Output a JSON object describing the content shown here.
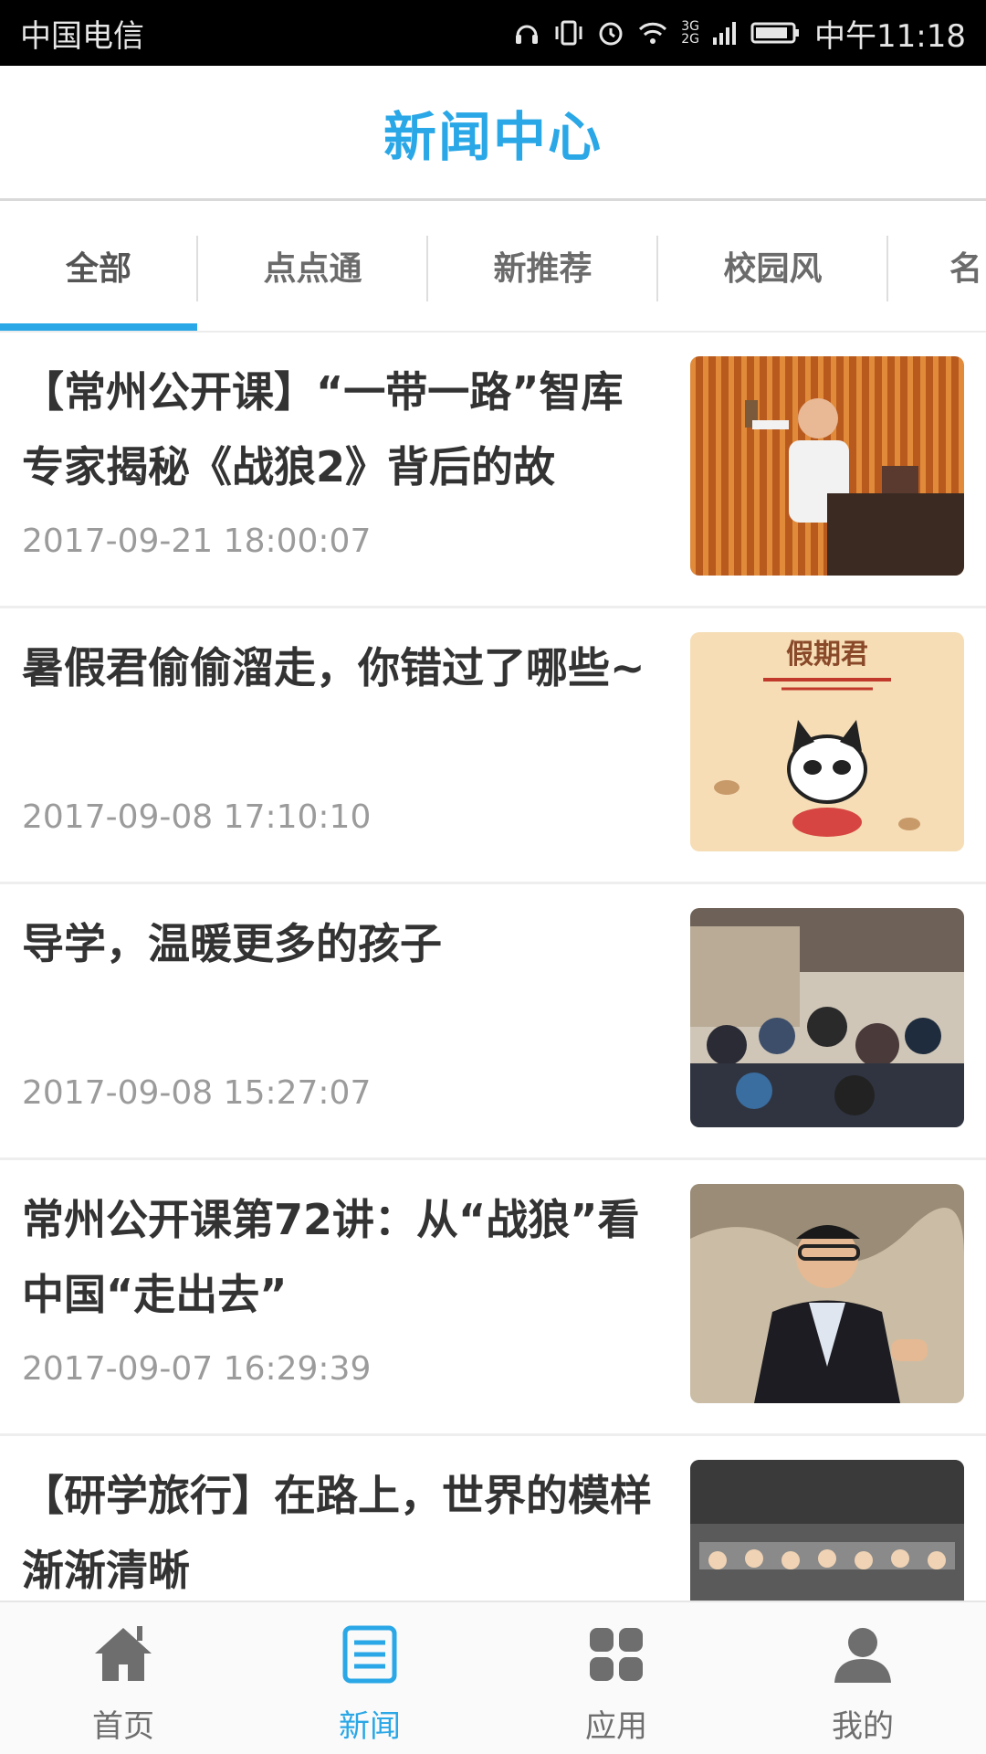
{
  "status_bar": {
    "carrier": "中国电信",
    "network": [
      "3G",
      "2G"
    ],
    "time": "中午11:18"
  },
  "header": {
    "title": "新闻中心"
  },
  "tabs": [
    {
      "label": "全部",
      "active": true
    },
    {
      "label": "点点通"
    },
    {
      "label": "新推荐"
    },
    {
      "label": "校园风"
    },
    {
      "label": "名"
    }
  ],
  "news": [
    {
      "title": "【常州公开课】“一带一路”智库专家揭秘《战狼2》背后的故",
      "date": "2017-09-21 18:00:07"
    },
    {
      "title": "暑假君偷偷溜走，你错过了哪些~",
      "date": "2017-09-08 17:10:10",
      "thumb_text": "假期君"
    },
    {
      "title": "导学，温暖更多的孩子",
      "date": "2017-09-08 15:27:07"
    },
    {
      "title": "常州公开课第72讲：从“战狼”看中国“走出去”",
      "date": "2017-09-07 16:29:39"
    },
    {
      "title": "【研学旅行】在路上，世界的模样渐渐清晰",
      "date": ""
    }
  ],
  "bottom_nav": [
    {
      "label": "首页",
      "icon": "home-icon"
    },
    {
      "label": "新闻",
      "icon": "news-icon",
      "active": true
    },
    {
      "label": "应用",
      "icon": "apps-grid-icon"
    },
    {
      "label": "我的",
      "icon": "person-icon"
    }
  ],
  "colors": {
    "accent": "#2aa7e6",
    "text": "#333333",
    "muted": "#9b9b9b"
  }
}
